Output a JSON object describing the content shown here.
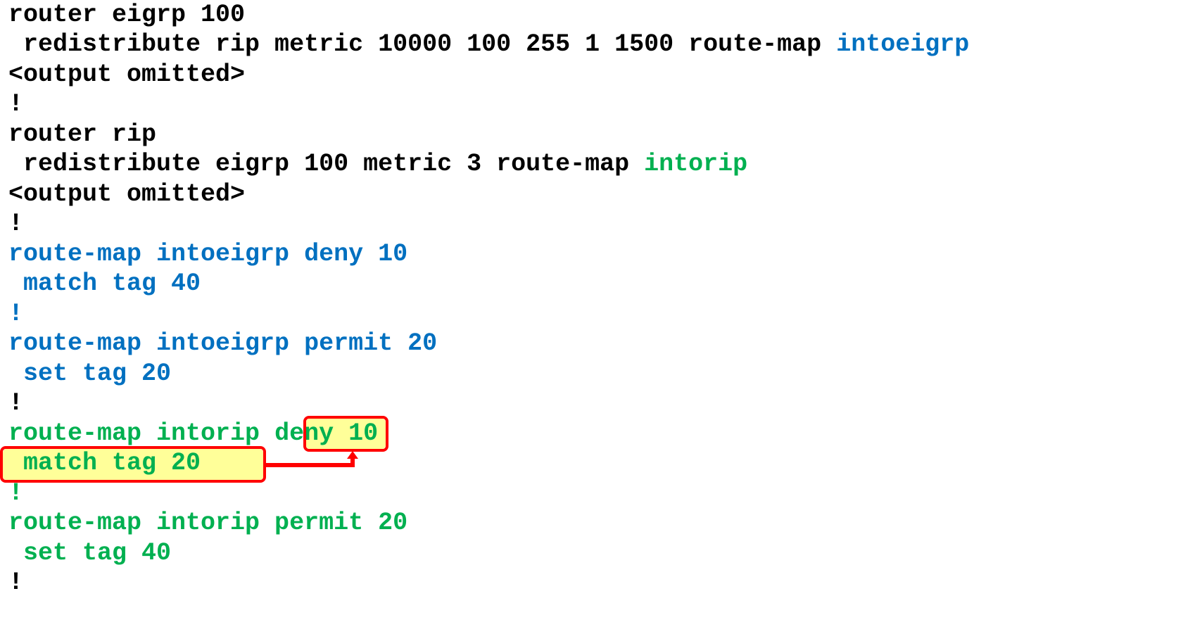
{
  "config_lines": {
    "l1": "router eigrp 100",
    "l2a": " redistribute rip metric 10000 100 255 1 1500 route-map ",
    "l2b": "intoeigrp",
    "l3": "<output omitted>",
    "l4": "!",
    "l5": "router rip",
    "l6a": " redistribute eigrp 100 metric 3 route-map ",
    "l6b": "intorip",
    "l7": "<output omitted>",
    "l8": "!",
    "l9": "route-map intoeigrp deny 10",
    "l10": " match tag 40",
    "l11": "!",
    "l12": "route-map intoeigrp permit 20",
    "l13": " set tag 20",
    "l14": "!",
    "l15a": "route-map intorip ",
    "l15b": "deny",
    "l15c": " 10",
    "l16": " match tag 20",
    "l17": "!",
    "l18": "route-map intorip permit 20",
    "l19": " set tag 40",
    "l20": "!"
  },
  "colors": {
    "default_text": "#000000",
    "intoeigrp": "#0070c0",
    "intorip": "#00b050",
    "highlight": "#ffff99",
    "callout": "#ff0000"
  }
}
